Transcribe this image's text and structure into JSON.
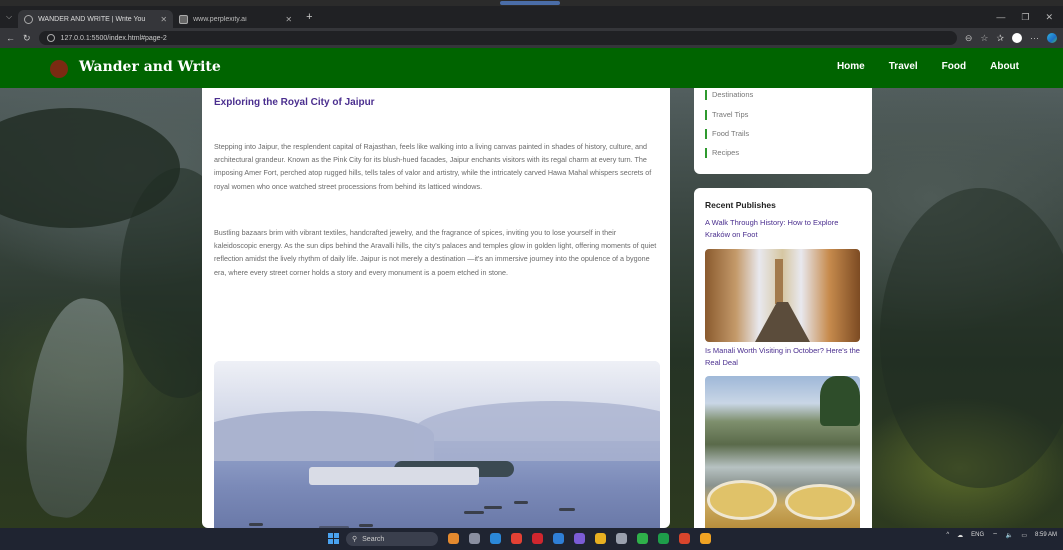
{
  "browser": {
    "tabs": [
      {
        "title": "WANDER AND WRITE | Write You",
        "active": true
      },
      {
        "title": "www.perplexity.ai",
        "active": false
      }
    ],
    "url": "127.0.0.1:5500/index.html#page-2"
  },
  "nav": {
    "brand": "Wander and Write",
    "links": [
      "Home",
      "Travel",
      "Food",
      "About"
    ]
  },
  "article": {
    "title": "Exploring the Royal City of Jaipur",
    "paragraph1": "Stepping into Jaipur, the resplendent capital of Rajasthan, feels like walking into a living canvas painted in shades of history, culture, and architectural grandeur. Known as the Pink City for its blush-hued facades, Jaipur enchants visitors with its regal charm at every turn. The imposing Amer Fort, perched atop rugged hills, tells tales of valor and artistry, while the intricately carved Hawa Mahal whispers secrets of royal women who once watched street processions from behind its latticed windows.",
    "paragraph2": "Bustling bazaars brim with vibrant textiles, handcrafted jewelry, and the fragrance of spices, inviting you to lose yourself in their kaleidoscopic energy. As the sun dips behind the Aravalli hills, the city's palaces and temples glow in golden light, offering moments of quiet reflection amidst the lively rhythm of daily life. Jaipur is not merely a destination —it's an immersive journey into the opulence of a bygone era, where every street corner holds a story and every monument is a poem etched in stone."
  },
  "sidebar": {
    "categories": [
      "Destinations",
      "Travel Tips",
      "Food Trails",
      "Recipes"
    ],
    "recent_heading": "Recent Publishes",
    "posts": [
      {
        "title": "A Walk Through History: How to Explore Kraków on Foot"
      },
      {
        "title": "Is Manali Worth Visiting in October? Here's the Real Deal"
      }
    ]
  },
  "taskbar": {
    "search_placeholder": "Search",
    "lang": "ENG",
    "time": "8:59 AM"
  },
  "colors": {
    "nav_green": "#006400",
    "title_purple": "#4b2f8f",
    "category_accent": "#2f9a2f"
  }
}
